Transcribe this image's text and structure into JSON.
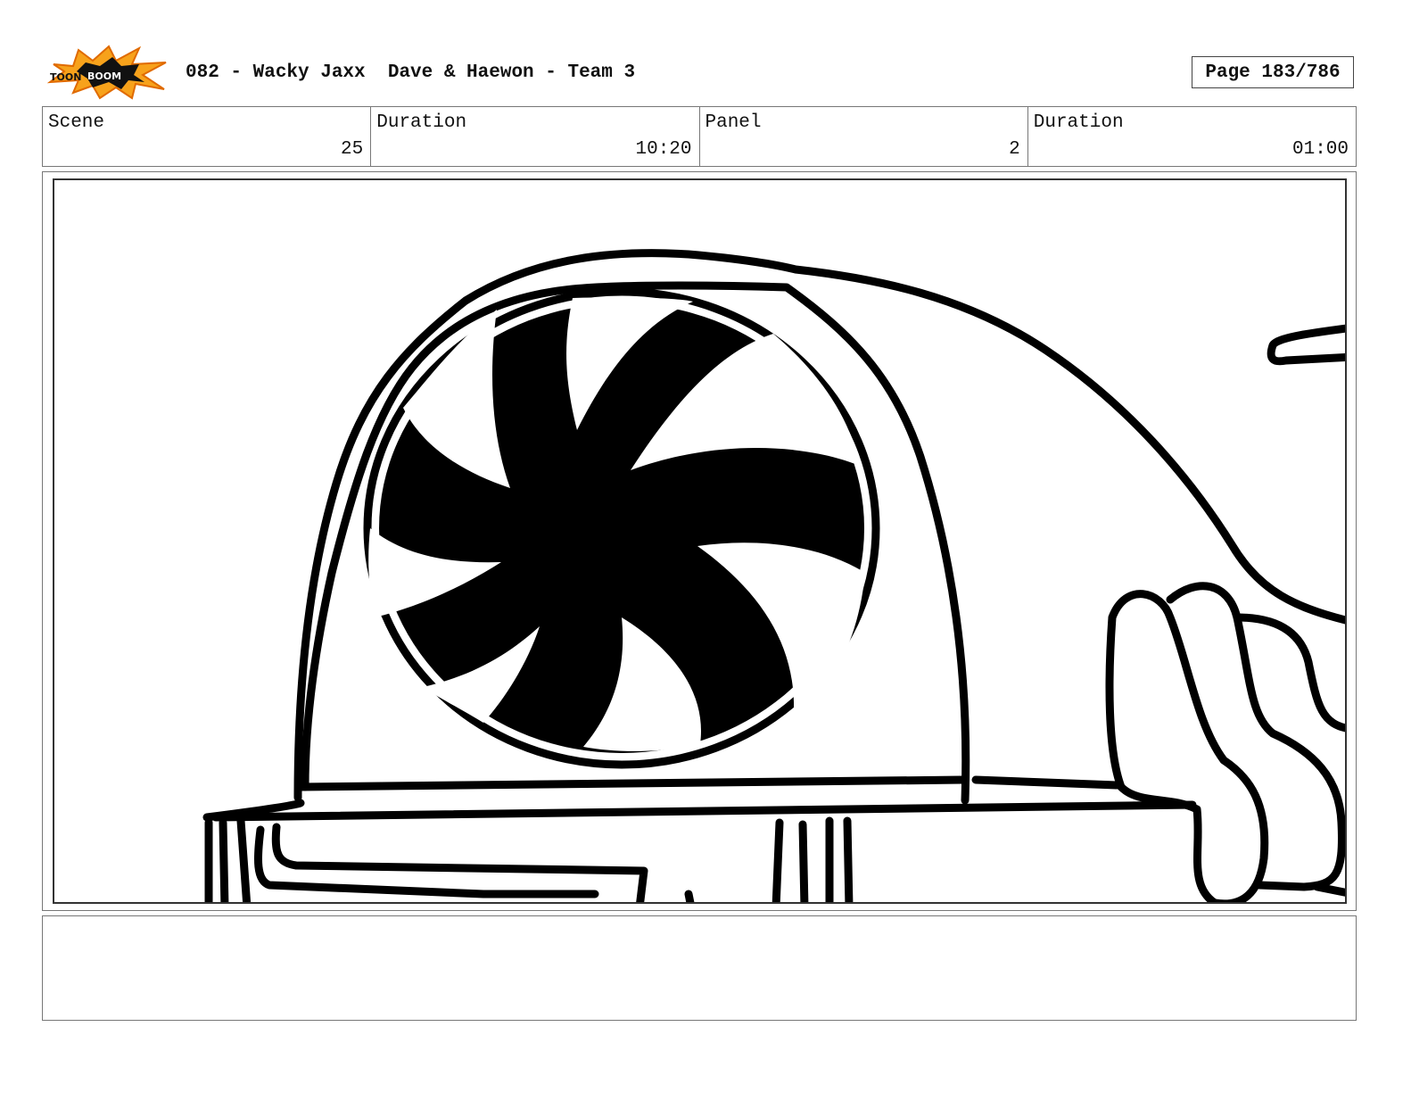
{
  "header": {
    "logo_text": "TOON BOOM",
    "title": "082 - Wacky Jaxx  Dave & Haewon - Team 3",
    "page": "Page 183/786"
  },
  "info": {
    "scene_label": "Scene",
    "scene_value": "25",
    "scene_duration_label": "Duration",
    "scene_duration_value": "10:20",
    "panel_label": "Panel",
    "panel_value": "2",
    "panel_duration_label": "Duration",
    "panel_duration_value": "01:00"
  },
  "notes": ""
}
